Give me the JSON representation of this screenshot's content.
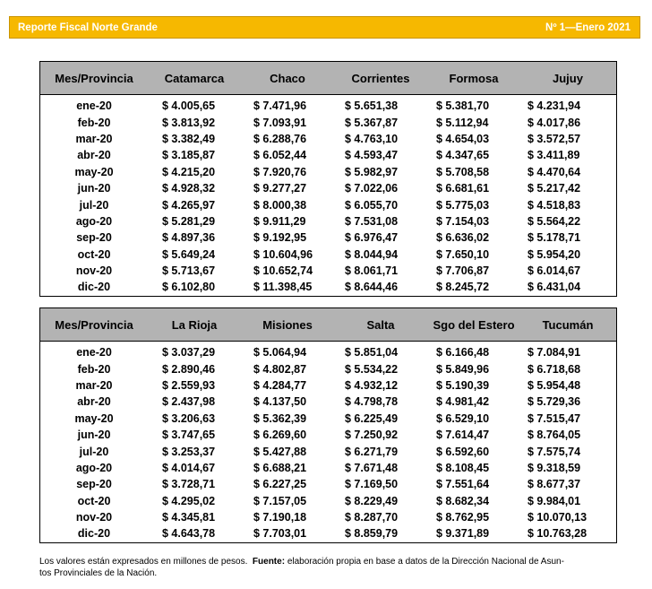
{
  "header": {
    "title": "Reporte Fiscal Norte Grande",
    "issue": "Nº 1—Enero 2021"
  },
  "table1": {
    "columns": [
      "Mes/Provincia",
      "Catamarca",
      "Chaco",
      "Corrientes",
      "Formosa",
      "Jujuy"
    ],
    "rows": [
      [
        "ene-20",
        "$ 4.005,65",
        "$ 7.471,96",
        "$ 5.651,38",
        "$ 5.381,70",
        "$ 4.231,94"
      ],
      [
        "feb-20",
        "$ 3.813,92",
        "$ 7.093,91",
        "$ 5.367,87",
        "$ 5.112,94",
        "$ 4.017,86"
      ],
      [
        "mar-20",
        "$ 3.382,49",
        "$ 6.288,76",
        "$ 4.763,10",
        "$ 4.654,03",
        "$ 3.572,57"
      ],
      [
        "abr-20",
        "$ 3.185,87",
        "$ 6.052,44",
        "$ 4.593,47",
        "$ 4.347,65",
        "$ 3.411,89"
      ],
      [
        "may-20",
        "$ 4.215,20",
        "$ 7.920,76",
        "$ 5.982,97",
        "$ 5.708,58",
        "$ 4.470,64"
      ],
      [
        "jun-20",
        "$ 4.928,32",
        "$ 9.277,27",
        "$ 7.022,06",
        "$ 6.681,61",
        "$ 5.217,42"
      ],
      [
        "jul-20",
        "$ 4.265,97",
        "$ 8.000,38",
        "$ 6.055,70",
        "$ 5.775,03",
        "$ 4.518,83"
      ],
      [
        "ago-20",
        "$ 5.281,29",
        "$ 9.911,29",
        "$ 7.531,08",
        "$ 7.154,03",
        "$ 5.564,22"
      ],
      [
        "sep-20",
        "$ 4.897,36",
        "$ 9.192,95",
        "$ 6.976,47",
        "$ 6.636,02",
        "$ 5.178,71"
      ],
      [
        "oct-20",
        "$ 5.649,24",
        "$ 10.604,96",
        "$ 8.044,94",
        "$ 7.650,10",
        "$ 5.954,20"
      ],
      [
        "nov-20",
        "$ 5.713,67",
        "$ 10.652,74",
        "$ 8.061,71",
        "$ 7.706,87",
        "$ 6.014,67"
      ],
      [
        "dic-20",
        "$ 6.102,80",
        "$ 11.398,45",
        "$ 8.644,46",
        "$ 8.245,72",
        "$ 6.431,04"
      ]
    ]
  },
  "table2": {
    "columns": [
      "Mes/Provincia",
      "La Rioja",
      "Misiones",
      "Salta",
      "Sgo del Estero",
      "Tucumán"
    ],
    "rows": [
      [
        "ene-20",
        "$ 3.037,29",
        "$ 5.064,94",
        "$ 5.851,04",
        "$ 6.166,48",
        "$ 7.084,91"
      ],
      [
        "feb-20",
        "$ 2.890,46",
        "$ 4.802,87",
        "$ 5.534,22",
        "$ 5.849,96",
        "$ 6.718,68"
      ],
      [
        "mar-20",
        "$ 2.559,93",
        "$ 4.284,77",
        "$ 4.932,12",
        "$ 5.190,39",
        "$ 5.954,48"
      ],
      [
        "abr-20",
        "$ 2.437,98",
        "$ 4.137,50",
        "$ 4.798,78",
        "$ 4.981,42",
        "$ 5.729,36"
      ],
      [
        "may-20",
        "$ 3.206,63",
        "$ 5.362,39",
        "$ 6.225,49",
        "$ 6.529,10",
        "$ 7.515,47"
      ],
      [
        "jun-20",
        "$ 3.747,65",
        "$ 6.269,60",
        "$ 7.250,92",
        "$ 7.614,47",
        "$ 8.764,05"
      ],
      [
        "jul-20",
        "$ 3.253,37",
        "$ 5.427,88",
        "$ 6.271,79",
        "$ 6.592,60",
        "$ 7.575,74"
      ],
      [
        "ago-20",
        "$ 4.014,67",
        "$ 6.688,21",
        "$ 7.671,48",
        "$ 8.108,45",
        "$ 9.318,59"
      ],
      [
        "sep-20",
        "$ 3.728,71",
        "$ 6.227,25",
        "$ 7.169,50",
        "$ 7.551,64",
        "$ 8.677,37"
      ],
      [
        "oct-20",
        "$ 4.295,02",
        "$ 7.157,05",
        "$ 8.229,49",
        "$ 8.682,34",
        "$ 9.984,01"
      ],
      [
        "nov-20",
        "$ 4.345,81",
        "$ 7.190,18",
        "$ 8.287,70",
        "$ 8.762,95",
        "$ 10.070,13"
      ],
      [
        "dic-20",
        "$ 4.643,78",
        "$ 7.703,01",
        "$ 8.859,79",
        "$ 9.371,89",
        "$ 10.763,28"
      ]
    ]
  },
  "footnote": {
    "text": "Los valores están expresados en millones de pesos.",
    "source_label": "Fuente:",
    "source_text": "elaboración propia en base a datos de la Dirección Nacional de Asun-tos Provinciales de la Nación.",
    "source_line1": "elaboración propia en base a datos de la Dirección Nacional de Asun-",
    "source_line2": "tos Provinciales de la Nación."
  }
}
